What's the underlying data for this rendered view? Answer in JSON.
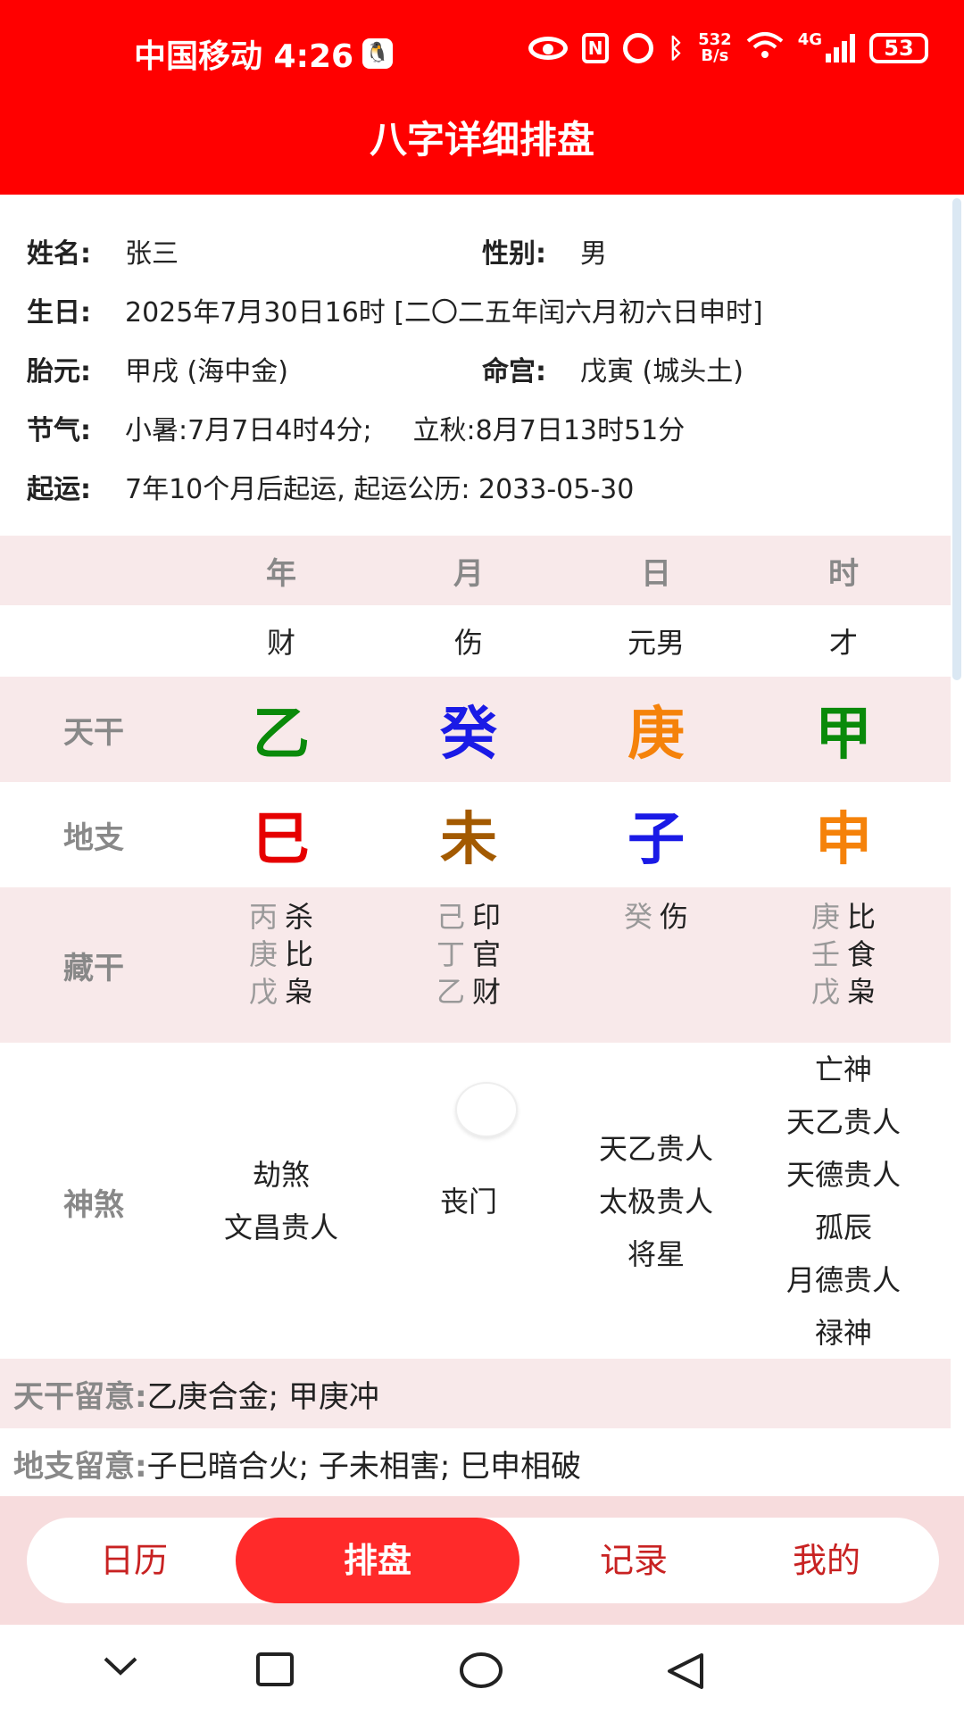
{
  "status_bar": {
    "carrier_time": "中国移动 4:26",
    "net_speed_top": "532",
    "net_speed_bottom": "B/s",
    "network": "4G",
    "battery": "53"
  },
  "header": {
    "title": "八字详细排盘"
  },
  "info": {
    "name_label": "姓名:",
    "name_value": "张三",
    "gender_label": "性别:",
    "gender_value": "男",
    "birthday_label": "生日:",
    "birthday_value": "2025年7月30日16时 [二〇二五年闰六月初六日申时]",
    "taiyuan_label": "胎元:",
    "taiyuan_value": "甲戌 (海中金)",
    "minggong_label": "命宫:",
    "minggong_value": "戊寅 (城头土)",
    "jieqi_label": "节气:",
    "jieqi_value1": "小暑:7月7日4时4分;",
    "jieqi_value2": "立秋:8月7日13时51分",
    "qiyun_label": "起运:",
    "qiyun_value": "7年10个月后起运,  起运公历: 2033-05-30"
  },
  "grid": {
    "columns": [
      "年",
      "月",
      "日",
      "时"
    ],
    "shishen": [
      "财",
      "伤",
      "元男",
      "才"
    ],
    "tiangan_label": "天干",
    "tiangan": [
      "乙",
      "癸",
      "庚",
      "甲"
    ],
    "tiangan_colors": [
      "#0a8a0a",
      "#1a1ae6",
      "#f5820a",
      "#0a8a0a"
    ],
    "dizhi_label": "地支",
    "dizhi": [
      "巳",
      "未",
      "子",
      "申"
    ],
    "dizhi_colors": [
      "#e60000",
      "#a35a00",
      "#1a1ae6",
      "#f5820a"
    ],
    "canggan_label": "藏干",
    "canggan": [
      [
        {
          "stem": "丙",
          "god": "杀"
        },
        {
          "stem": "庚",
          "god": "比"
        },
        {
          "stem": "戊",
          "god": "枭"
        }
      ],
      [
        {
          "stem": "己",
          "god": "印"
        },
        {
          "stem": "丁",
          "god": "官"
        },
        {
          "stem": "乙",
          "god": "财"
        }
      ],
      [
        {
          "stem": "癸",
          "god": "伤"
        }
      ],
      [
        {
          "stem": "庚",
          "god": "比"
        },
        {
          "stem": "壬",
          "god": "食"
        },
        {
          "stem": "戊",
          "god": "枭"
        }
      ]
    ],
    "shensha_label": "神煞",
    "shensha": [
      [
        "劫煞",
        "文昌贵人"
      ],
      [
        "丧门"
      ],
      [
        "天乙贵人",
        "太极贵人",
        "将星"
      ],
      [
        "亡神",
        "天乙贵人",
        "天德贵人",
        "孤辰",
        "月德贵人",
        "禄神"
      ]
    ]
  },
  "notes": {
    "tiangan_label": "天干留意:",
    "tiangan_value": "乙庚合金; 甲庚冲",
    "dizhi_label": "地支留意:",
    "dizhi_value": "子巳暗合火; 子未相害; 巳申相破"
  },
  "tabs": [
    {
      "label": "日历",
      "active": false
    },
    {
      "label": "排盘",
      "active": true
    },
    {
      "label": "记录",
      "active": false
    },
    {
      "label": "我的",
      "active": false
    }
  ],
  "nav_icons": [
    "chevron-down-icon",
    "square-icon",
    "circle-icon",
    "back-triangle-icon"
  ]
}
